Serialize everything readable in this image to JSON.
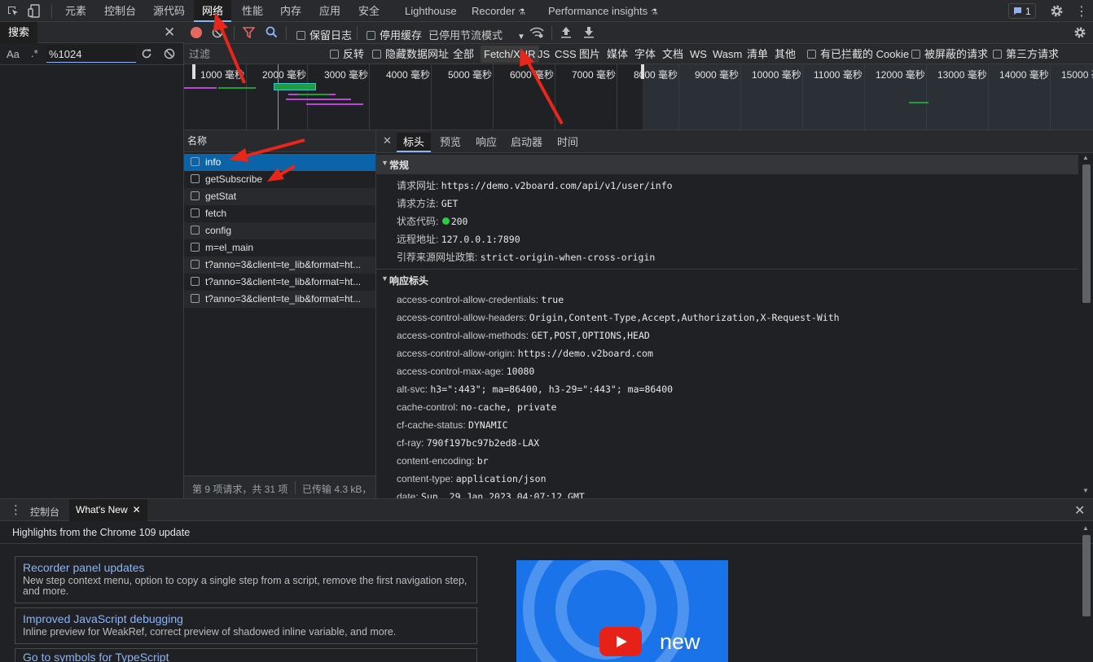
{
  "top_tabs": [
    "元素",
    "控制台",
    "源代码",
    "网络",
    "性能",
    "内存",
    "应用",
    "安全",
    "Lighthouse",
    "Recorder",
    "Performance insights"
  ],
  "issues_count": "1",
  "search": {
    "title": "搜索",
    "case_label": "Aa",
    "regex_label": ".*",
    "query": "%1024"
  },
  "network_toolbar": {
    "preserve_log": "保留日志",
    "disable_cache": "停用缓存",
    "throttle": "已停用节流模式"
  },
  "filter_bar": {
    "placeholder": "过滤",
    "invert": "反转",
    "hide_data_urls": "隐藏数据网址",
    "types": [
      "全部",
      "Fetch/XHR",
      "JS",
      "CSS",
      "图片",
      "媒体",
      "字体",
      "文档",
      "WS",
      "Wasm",
      "清单",
      "其他"
    ],
    "blocked_cookies": "有已拦截的 Cookie",
    "blocked_requests": "被屏蔽的请求",
    "third_party": "第三方请求"
  },
  "overview_ticks": [
    "1000 毫秒",
    "2000 毫秒",
    "3000 毫秒",
    "4000 毫秒",
    "5000 毫秒",
    "6000 毫秒",
    "7000 毫秒",
    "8000 毫秒",
    "9000 毫秒",
    "10000 毫秒",
    "11000 毫秒",
    "12000 毫秒",
    "13000 毫秒",
    "14000 毫秒",
    "15000 毫"
  ],
  "request_list": {
    "header": "名称",
    "items": [
      "info",
      "getSubscribe",
      "getStat",
      "fetch",
      "config",
      "m=el_main",
      "t?anno=3&client=te_lib&format=ht...",
      "t?anno=3&client=te_lib&format=ht...",
      "t?anno=3&client=te_lib&format=ht..."
    ],
    "status": "第 9 项请求，共 31 项",
    "transferred": "已传输 4.3 kB，"
  },
  "detail_tabs": [
    "标头",
    "预览",
    "响应",
    "启动器",
    "时间"
  ],
  "general": {
    "title": "常规",
    "rows": [
      {
        "k": "请求网址:",
        "v": "https://demo.v2board.com/api/v1/user/info"
      },
      {
        "k": "请求方法:",
        "v": "GET"
      },
      {
        "k": "状态代码:",
        "v": "200"
      },
      {
        "k": "远程地址:",
        "v": "127.0.0.1:7890"
      },
      {
        "k": "引荐来源网址政策:",
        "v": "strict-origin-when-cross-origin"
      }
    ]
  },
  "response_headers": {
    "title": "响应标头",
    "rows": [
      {
        "k": "access-control-allow-credentials:",
        "v": "true"
      },
      {
        "k": "access-control-allow-headers:",
        "v": "Origin,Content-Type,Accept,Authorization,X-Request-With"
      },
      {
        "k": "access-control-allow-methods:",
        "v": "GET,POST,OPTIONS,HEAD"
      },
      {
        "k": "access-control-allow-origin:",
        "v": "https://demo.v2board.com"
      },
      {
        "k": "access-control-max-age:",
        "v": "10080"
      },
      {
        "k": "alt-svc:",
        "v": "h3=\":443\"; ma=86400, h3-29=\":443\"; ma=86400"
      },
      {
        "k": "cache-control:",
        "v": "no-cache, private"
      },
      {
        "k": "cf-cache-status:",
        "v": "DYNAMIC"
      },
      {
        "k": "cf-ray:",
        "v": "790f197bc97b2ed8-LAX"
      },
      {
        "k": "content-encoding:",
        "v": "br"
      },
      {
        "k": "content-type:",
        "v": "application/json"
      },
      {
        "k": "date:",
        "v": "Sun, 29 Jan 2023 04:07:12 GMT"
      }
    ]
  },
  "drawer": {
    "tabs": [
      "控制台",
      "What's New"
    ],
    "headline": "Highlights from the Chrome 109 update",
    "cards": [
      {
        "title": "Recorder panel updates",
        "desc": "New step context menu, option to copy a single step from a script, remove the first navigation step, and more."
      },
      {
        "title": "Improved JavaScript debugging",
        "desc": "Inline preview for WeakRef, correct preview of shadowed inline variable, and more."
      },
      {
        "title": "Go to symbols for TypeScript",
        "desc": ""
      }
    ],
    "video_label": "new"
  },
  "colors": {
    "accent": "#8ab4f8",
    "selected_row": "#0b63a8",
    "record_red": "#e46962",
    "status_green": "#2ecc40",
    "annotation_red": "#e8271a"
  }
}
